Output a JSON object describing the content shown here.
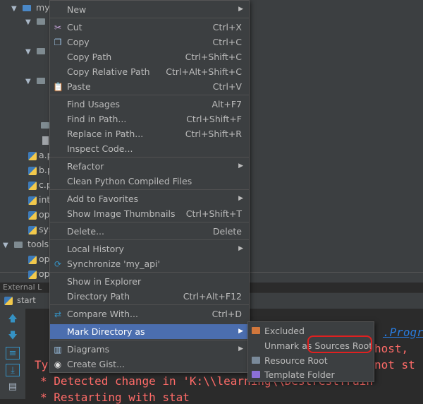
{
  "tree": {
    "root_label": "my",
    "files": [
      "a.p",
      "b.p",
      "c.p",
      "int",
      "op",
      "sys"
    ],
    "tools_label": "tools",
    "tools_files": [
      "op",
      "op"
    ],
    "external_label": "External L"
  },
  "run": {
    "tab_label": "start",
    "console": {
      "link_text": ".Progr",
      "line_host": "host,",
      "line_ty": "Ty",
      "line_not_st": "not st",
      "line_detected": "* Detected change in 'K:\\\\learning\\\\DestrestTrain",
      "line_restarting": "* Restarting with stat"
    }
  },
  "menu": {
    "items": [
      {
        "label": "New",
        "shortcut": "",
        "submenu": true,
        "icon": ""
      },
      {
        "label": "Cut",
        "shortcut": "Ctrl+X",
        "submenu": false,
        "icon": "scissors-icon"
      },
      {
        "label": "Copy",
        "shortcut": "Ctrl+C",
        "submenu": false,
        "icon": "copy-icon"
      },
      {
        "label": "Copy Path",
        "shortcut": "Ctrl+Shift+C",
        "submenu": false,
        "icon": ""
      },
      {
        "label": "Copy Relative Path",
        "shortcut": "Ctrl+Alt+Shift+C",
        "submenu": false,
        "icon": ""
      },
      {
        "label": "Paste",
        "shortcut": "Ctrl+V",
        "submenu": false,
        "icon": "paste-icon"
      },
      {
        "label": "Find Usages",
        "shortcut": "Alt+F7",
        "submenu": false,
        "icon": ""
      },
      {
        "label": "Find in Path...",
        "shortcut": "Ctrl+Shift+F",
        "submenu": false,
        "icon": ""
      },
      {
        "label": "Replace in Path...",
        "shortcut": "Ctrl+Shift+R",
        "submenu": false,
        "icon": ""
      },
      {
        "label": "Inspect Code...",
        "shortcut": "",
        "submenu": false,
        "icon": ""
      },
      {
        "label": "Refactor",
        "shortcut": "",
        "submenu": true,
        "icon": ""
      },
      {
        "label": "Clean Python Compiled Files",
        "shortcut": "",
        "submenu": false,
        "icon": ""
      },
      {
        "label": "Add to Favorites",
        "shortcut": "",
        "submenu": true,
        "icon": ""
      },
      {
        "label": "Show Image Thumbnails",
        "shortcut": "Ctrl+Shift+T",
        "submenu": false,
        "icon": ""
      },
      {
        "label": "Delete...",
        "shortcut": "Delete",
        "submenu": false,
        "icon": ""
      },
      {
        "label": "Local History",
        "shortcut": "",
        "submenu": true,
        "icon": ""
      },
      {
        "label": "Synchronize 'my_api'",
        "shortcut": "",
        "submenu": false,
        "icon": "sync-icon"
      },
      {
        "label": "Show in Explorer",
        "shortcut": "",
        "submenu": false,
        "icon": ""
      },
      {
        "label": "Directory Path",
        "shortcut": "Ctrl+Alt+F12",
        "submenu": false,
        "icon": ""
      },
      {
        "label": "Compare With...",
        "shortcut": "Ctrl+D",
        "submenu": false,
        "icon": "compare-icon"
      },
      {
        "label": "Mark Directory as",
        "shortcut": "",
        "submenu": true,
        "icon": ""
      },
      {
        "label": "Diagrams",
        "shortcut": "",
        "submenu": true,
        "icon": "diagram-icon"
      },
      {
        "label": "Create Gist...",
        "shortcut": "",
        "submenu": false,
        "icon": "github-icon"
      }
    ]
  },
  "submenu": {
    "items": [
      {
        "label": "Excluded",
        "icon_color": "#d1773c"
      },
      {
        "label": "Unmark as Sources Root",
        "icon_color": ""
      },
      {
        "label": "Resource Root",
        "icon_color": "#7a8a9a"
      },
      {
        "label": "Template Folder",
        "icon_color": "#8c6fd6"
      }
    ]
  },
  "colors": {
    "menu_bg": "#3c3f41",
    "selection": "#4b6eaf",
    "annotation_circle": "#e02020",
    "console_error": "#ff6b68"
  }
}
